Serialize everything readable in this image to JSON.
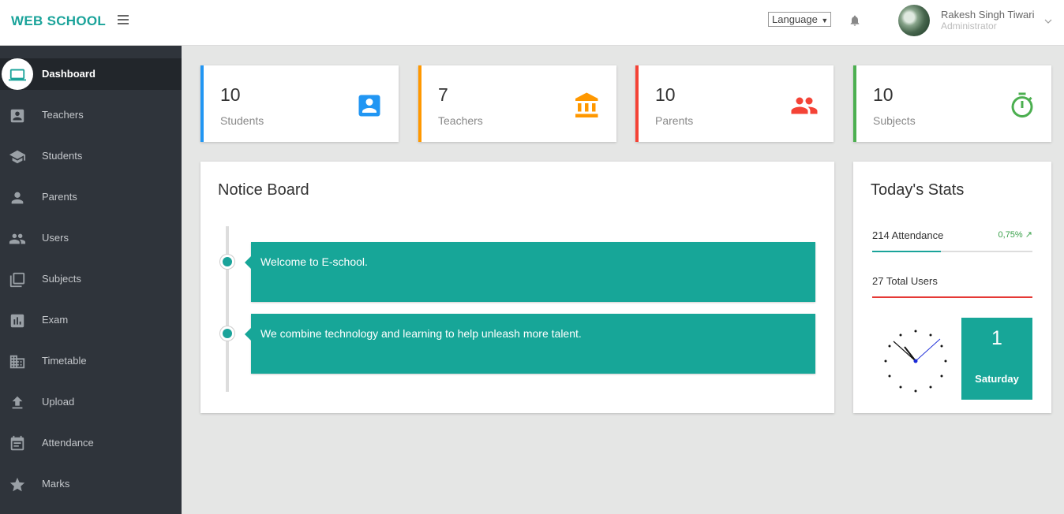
{
  "brand": "WEB SCHOOL",
  "header": {
    "language_label": "Language",
    "user_name": "Rakesh Singh Tiwari",
    "user_role": "Administrator"
  },
  "sidebar": {
    "items": [
      {
        "label": "Dashboard",
        "icon": "laptop-icon",
        "active": true
      },
      {
        "label": "Teachers",
        "icon": "contact-card-icon"
      },
      {
        "label": "Students",
        "icon": "graduation-cap-icon"
      },
      {
        "label": "Parents",
        "icon": "person-icon"
      },
      {
        "label": "Users",
        "icon": "people-icon"
      },
      {
        "label": "Subjects",
        "icon": "library-icon"
      },
      {
        "label": "Exam",
        "icon": "bar-chart-icon"
      },
      {
        "label": "Timetable",
        "icon": "building-icon"
      },
      {
        "label": "Upload",
        "icon": "upload-icon"
      },
      {
        "label": "Attendance",
        "icon": "calendar-icon"
      },
      {
        "label": "Marks",
        "icon": "star-icon"
      }
    ]
  },
  "stats": [
    {
      "value": "10",
      "label": "Students",
      "color": "#2196f3",
      "icon": "account-box-icon"
    },
    {
      "value": "7",
      "label": "Teachers",
      "color": "#ff9800",
      "icon": "bank-icon"
    },
    {
      "value": "10",
      "label": "Parents",
      "color": "#f44336",
      "icon": "group-icon"
    },
    {
      "value": "10",
      "label": "Subjects",
      "color": "#4caf50",
      "icon": "stopwatch-icon"
    }
  ],
  "notice_board": {
    "title": "Notice Board",
    "notices": [
      "Welcome to E-school.",
      "We combine technology and learning to help unleash more talent."
    ]
  },
  "todays_stats": {
    "title": "Today's Stats",
    "attendance_label": "214 Attendance",
    "attendance_change": "0,75%",
    "attendance_fraction": 0.43,
    "total_users_label": "27 Total Users",
    "total_users_fraction": 1.0,
    "day_number": "1",
    "day_name": "Saturday"
  },
  "colors": {
    "accent": "#1aa39a",
    "sidebar": "#2f343b",
    "positive": "#39a14a",
    "danger": "#e53935"
  }
}
